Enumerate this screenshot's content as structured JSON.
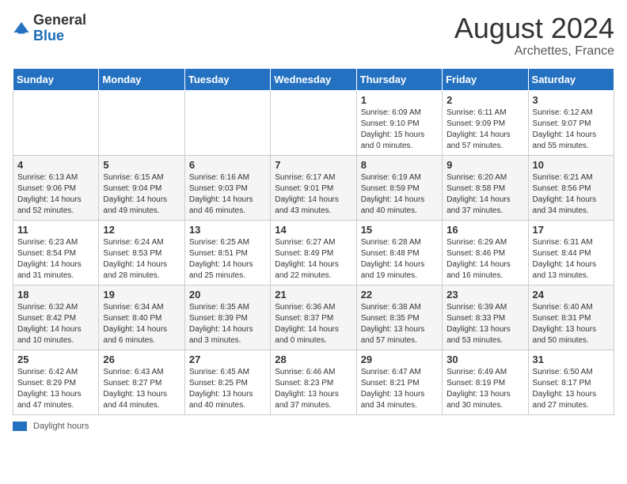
{
  "header": {
    "logo_general": "General",
    "logo_blue": "Blue",
    "title": "August 2024",
    "subtitle": "Archettes, France"
  },
  "weekdays": [
    "Sunday",
    "Monday",
    "Tuesday",
    "Wednesday",
    "Thursday",
    "Friday",
    "Saturday"
  ],
  "weeks": [
    [
      {
        "day": "",
        "info": ""
      },
      {
        "day": "",
        "info": ""
      },
      {
        "day": "",
        "info": ""
      },
      {
        "day": "",
        "info": ""
      },
      {
        "day": "1",
        "info": "Sunrise: 6:09 AM\nSunset: 9:10 PM\nDaylight: 15 hours\nand 0 minutes."
      },
      {
        "day": "2",
        "info": "Sunrise: 6:11 AM\nSunset: 9:09 PM\nDaylight: 14 hours\nand 57 minutes."
      },
      {
        "day": "3",
        "info": "Sunrise: 6:12 AM\nSunset: 9:07 PM\nDaylight: 14 hours\nand 55 minutes."
      }
    ],
    [
      {
        "day": "4",
        "info": "Sunrise: 6:13 AM\nSunset: 9:06 PM\nDaylight: 14 hours\nand 52 minutes."
      },
      {
        "day": "5",
        "info": "Sunrise: 6:15 AM\nSunset: 9:04 PM\nDaylight: 14 hours\nand 49 minutes."
      },
      {
        "day": "6",
        "info": "Sunrise: 6:16 AM\nSunset: 9:03 PM\nDaylight: 14 hours\nand 46 minutes."
      },
      {
        "day": "7",
        "info": "Sunrise: 6:17 AM\nSunset: 9:01 PM\nDaylight: 14 hours\nand 43 minutes."
      },
      {
        "day": "8",
        "info": "Sunrise: 6:19 AM\nSunset: 8:59 PM\nDaylight: 14 hours\nand 40 minutes."
      },
      {
        "day": "9",
        "info": "Sunrise: 6:20 AM\nSunset: 8:58 PM\nDaylight: 14 hours\nand 37 minutes."
      },
      {
        "day": "10",
        "info": "Sunrise: 6:21 AM\nSunset: 8:56 PM\nDaylight: 14 hours\nand 34 minutes."
      }
    ],
    [
      {
        "day": "11",
        "info": "Sunrise: 6:23 AM\nSunset: 8:54 PM\nDaylight: 14 hours\nand 31 minutes."
      },
      {
        "day": "12",
        "info": "Sunrise: 6:24 AM\nSunset: 8:53 PM\nDaylight: 14 hours\nand 28 minutes."
      },
      {
        "day": "13",
        "info": "Sunrise: 6:25 AM\nSunset: 8:51 PM\nDaylight: 14 hours\nand 25 minutes."
      },
      {
        "day": "14",
        "info": "Sunrise: 6:27 AM\nSunset: 8:49 PM\nDaylight: 14 hours\nand 22 minutes."
      },
      {
        "day": "15",
        "info": "Sunrise: 6:28 AM\nSunset: 8:48 PM\nDaylight: 14 hours\nand 19 minutes."
      },
      {
        "day": "16",
        "info": "Sunrise: 6:29 AM\nSunset: 8:46 PM\nDaylight: 14 hours\nand 16 minutes."
      },
      {
        "day": "17",
        "info": "Sunrise: 6:31 AM\nSunset: 8:44 PM\nDaylight: 14 hours\nand 13 minutes."
      }
    ],
    [
      {
        "day": "18",
        "info": "Sunrise: 6:32 AM\nSunset: 8:42 PM\nDaylight: 14 hours\nand 10 minutes."
      },
      {
        "day": "19",
        "info": "Sunrise: 6:34 AM\nSunset: 8:40 PM\nDaylight: 14 hours\nand 6 minutes."
      },
      {
        "day": "20",
        "info": "Sunrise: 6:35 AM\nSunset: 8:39 PM\nDaylight: 14 hours\nand 3 minutes."
      },
      {
        "day": "21",
        "info": "Sunrise: 6:36 AM\nSunset: 8:37 PM\nDaylight: 14 hours\nand 0 minutes."
      },
      {
        "day": "22",
        "info": "Sunrise: 6:38 AM\nSunset: 8:35 PM\nDaylight: 13 hours\nand 57 minutes."
      },
      {
        "day": "23",
        "info": "Sunrise: 6:39 AM\nSunset: 8:33 PM\nDaylight: 13 hours\nand 53 minutes."
      },
      {
        "day": "24",
        "info": "Sunrise: 6:40 AM\nSunset: 8:31 PM\nDaylight: 13 hours\nand 50 minutes."
      }
    ],
    [
      {
        "day": "25",
        "info": "Sunrise: 6:42 AM\nSunset: 8:29 PM\nDaylight: 13 hours\nand 47 minutes."
      },
      {
        "day": "26",
        "info": "Sunrise: 6:43 AM\nSunset: 8:27 PM\nDaylight: 13 hours\nand 44 minutes."
      },
      {
        "day": "27",
        "info": "Sunrise: 6:45 AM\nSunset: 8:25 PM\nDaylight: 13 hours\nand 40 minutes."
      },
      {
        "day": "28",
        "info": "Sunrise: 6:46 AM\nSunset: 8:23 PM\nDaylight: 13 hours\nand 37 minutes."
      },
      {
        "day": "29",
        "info": "Sunrise: 6:47 AM\nSunset: 8:21 PM\nDaylight: 13 hours\nand 34 minutes."
      },
      {
        "day": "30",
        "info": "Sunrise: 6:49 AM\nSunset: 8:19 PM\nDaylight: 13 hours\nand 30 minutes."
      },
      {
        "day": "31",
        "info": "Sunrise: 6:50 AM\nSunset: 8:17 PM\nDaylight: 13 hours\nand 27 minutes."
      }
    ]
  ],
  "footer": {
    "daylight_label": "Daylight hours"
  }
}
